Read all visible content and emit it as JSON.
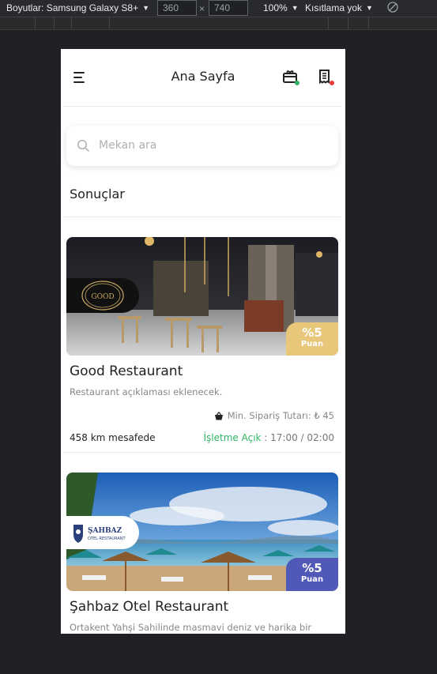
{
  "devtools": {
    "device_label": "Boyutlar: Samsung Galaxy S8+",
    "width_value": "360",
    "height_value": "740",
    "times_sign": "×",
    "zoom": "100%",
    "throttle": "Kısıtlama yok",
    "rotate_icon": "rotate-icon"
  },
  "app": {
    "title": "Ana Sayfa",
    "menu_icon": "hamburger-menu-icon",
    "gift_icon": "gift-card-icon",
    "orders_icon": "receipt-icon",
    "colors": {
      "gift_dot": "#2fb463",
      "orders_dot": "#e53935",
      "open_status": "#2fb463",
      "puan_gold": "#e9c77a",
      "puan_blue": "#5059b8"
    }
  },
  "search": {
    "placeholder": "Mekan ara",
    "icon": "search-icon"
  },
  "results": {
    "title": "Sonuçlar",
    "items": [
      {
        "name": "Good Restaurant",
        "description": "Restaurant açıklaması eklenecek.",
        "logo_text": "GOOD",
        "puan_percent": "%5",
        "puan_label": "Puan",
        "min_order": "Min. Sipariş Tutarı: ₺ 45",
        "distance": "458 km mesafede",
        "status_label": "İşletme Açık",
        "hours": " : 17:00 / 02:00"
      },
      {
        "name": "Şahbaz Otel Restaurant",
        "description": "Ortakent Yahşi Sahilinde masmavi deniz ve harika bir",
        "logo_text": "ŞAHBAZ",
        "logo_subtext": "OTEL·RESTAURANT",
        "puan_percent": "%5",
        "puan_label": "Puan"
      }
    ]
  }
}
